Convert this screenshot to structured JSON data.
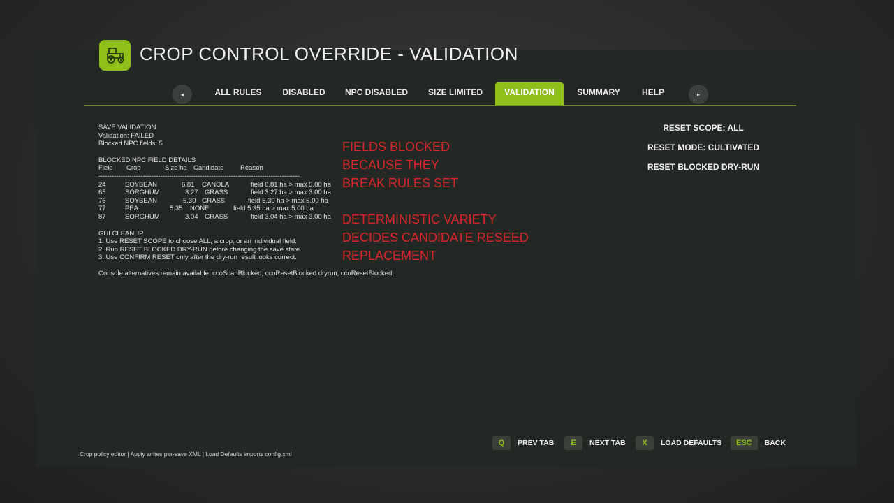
{
  "header": {
    "title": "CROP CONTROL OVERRIDE - VALIDATION",
    "logo_icon": "tractor-icon"
  },
  "tabs": {
    "prev_icon": "◂",
    "next_icon": "▸",
    "items": [
      {
        "label": "ALL RULES"
      },
      {
        "label": "DISABLED"
      },
      {
        "label": "NPC DISABLED"
      },
      {
        "label": "SIZE LIMITED"
      },
      {
        "label": "VALIDATION",
        "active": true
      },
      {
        "label": "SUMMARY"
      },
      {
        "label": "HELP"
      }
    ],
    "accent": "#8fbf1a"
  },
  "validation": {
    "section_title": "SAVE VALIDATION",
    "status_line": "Validation:    FAILED",
    "blocked_count": "Blocked NPC fields: 5",
    "details_title": "BLOCKED NPC FIELD DETAILS",
    "columns": [
      "Field",
      "Crop",
      "Size ha",
      "Candidate",
      "Reason"
    ],
    "separator": "-------------------------------------------------------------------------------------------",
    "rows": [
      {
        "field": "24",
        "crop": "SOYBEAN",
        "size": "6.81",
        "candidate": "CANOLA",
        "reason": "field 6.81 ha > max 5.00 ha"
      },
      {
        "field": "65",
        "crop": "SORGHUM",
        "size": "3.27",
        "candidate": "GRASS",
        "reason": "field 3.27 ha > max 3.00 ha"
      },
      {
        "field": "76",
        "crop": "SOYBEAN",
        "size": "5.30",
        "candidate": "GRASS",
        "reason": "field 5.30 ha > max 5.00 ha"
      },
      {
        "field": "77",
        "crop": "PEA",
        "size": "5.35",
        "candidate": "NONE",
        "reason": "field 5.35 ha > max 5.00 ha"
      },
      {
        "field": "87",
        "crop": "SORGHUM",
        "size": "3.04",
        "candidate": "GRASS",
        "reason": "field 3.04 ha > max 3.00 ha"
      }
    ],
    "cleanup_title": "GUI CLEANUP",
    "cleanup_steps": [
      "1. Use RESET SCOPE to choose ALL, a crop, or an individual field.",
      "2. Run RESET BLOCKED DRY-RUN before changing the save state.",
      "3. Use CONFIRM RESET only after the dry-run result looks correct."
    ],
    "console_note": "Console alternatives remain available: ccoScanBlocked, ccoResetBlocked dryrun, ccoResetBlocked."
  },
  "annotations": {
    "note1": [
      "FIELDS BLOCKED",
      "BECAUSE THEY",
      "BREAK RULES SET"
    ],
    "note2": [
      "DETERMINISTIC VARIETY",
      "DECIDES CANDIDATE RESEED",
      "REPLACEMENT"
    ],
    "color": "#d6262b"
  },
  "reset_panel": {
    "scope": "RESET SCOPE: ALL",
    "mode": "RESET MODE: CULTIVATED",
    "dryrun": "RESET BLOCKED DRY-RUN"
  },
  "key_hints": [
    {
      "key": "Q",
      "label": "PREV TAB"
    },
    {
      "key": "E",
      "label": "NEXT TAB"
    },
    {
      "key": "X",
      "label": "LOAD DEFAULTS"
    },
    {
      "key": "ESC",
      "label": "BACK"
    }
  ],
  "footer": {
    "text": "Crop policy editor | Apply writes per-save XML | Load Defaults imports config.xml"
  }
}
